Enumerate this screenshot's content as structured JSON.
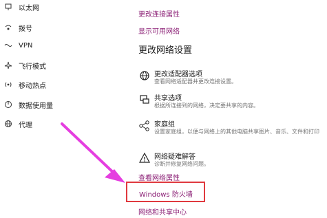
{
  "sidebar": {
    "items": [
      {
        "label": "以太网",
        "icon": "ethernet-icon"
      },
      {
        "label": "拨号",
        "icon": "dialup-icon"
      },
      {
        "label": "VPN",
        "icon": "vpn-icon"
      },
      {
        "label": "飞行模式",
        "icon": "airplane-icon"
      },
      {
        "label": "移动热点",
        "icon": "hotspot-icon"
      },
      {
        "label": "数据使用量",
        "icon": "data-usage-icon"
      },
      {
        "label": "代理",
        "icon": "globe-icon"
      }
    ]
  },
  "main": {
    "links_top": {
      "change_connection_properties": "更改连接属性",
      "show_available_networks": "显示可用网络"
    },
    "section_title": "更改网络设置",
    "options": [
      {
        "title": "更改适配器选项",
        "desc": "查看网络适配器并更改连接设置。",
        "icon": "adapter-icon"
      },
      {
        "title": "共享选项",
        "desc": "根据所连接到的网络，决定要共享的内容。",
        "icon": "sharing-icon"
      },
      {
        "title": "家庭组",
        "desc": "设置家庭组，以便与网络上的其他电脑共享图片、音乐、文件和打印",
        "icon": "homegroup-icon"
      },
      {
        "title": "网络疑难解答",
        "desc": "诊断并修复网络问题。",
        "icon": "warning-icon"
      }
    ],
    "links_bottom": {
      "view_network_properties": "查看网络属性",
      "windows_firewall": "Windows 防火墙",
      "network_sharing_center": "网络和共享中心"
    }
  },
  "colors": {
    "link": "#8b1f75",
    "highlight_box": "#e0393e",
    "arrow": "#e53ee0"
  }
}
